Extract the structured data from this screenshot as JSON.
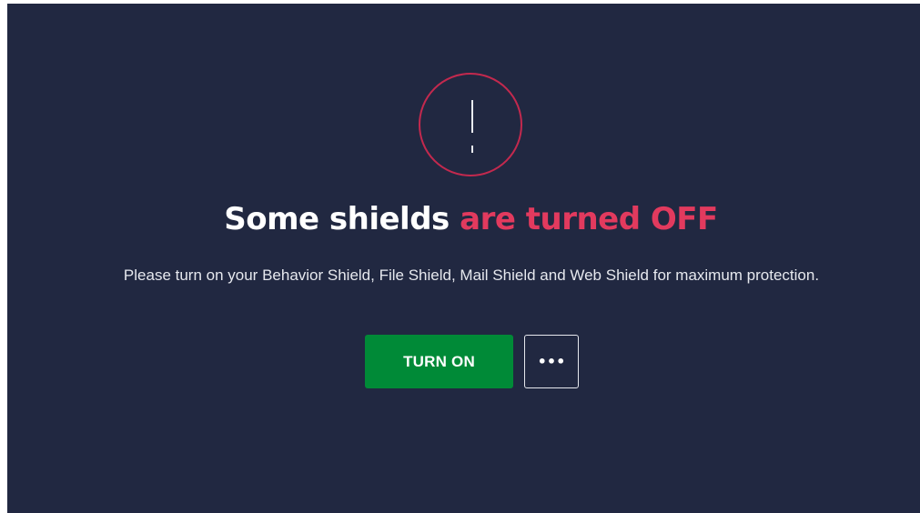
{
  "alert": {
    "icon": "exclamation-icon",
    "ring_color": "#c3294e"
  },
  "headline": {
    "part1": "Some shields ",
    "part2": "are turned OFF",
    "accent_color": "#e23a5e"
  },
  "description": "Please turn on your Behavior Shield, File Shield, Mail Shield and Web Shield for maximum protection.",
  "actions": {
    "turn_on_label": "TURN ON",
    "more_label": "•••",
    "more_icon": "more-options-icon",
    "primary_color": "#008a37"
  },
  "theme": {
    "background": "#212841"
  }
}
